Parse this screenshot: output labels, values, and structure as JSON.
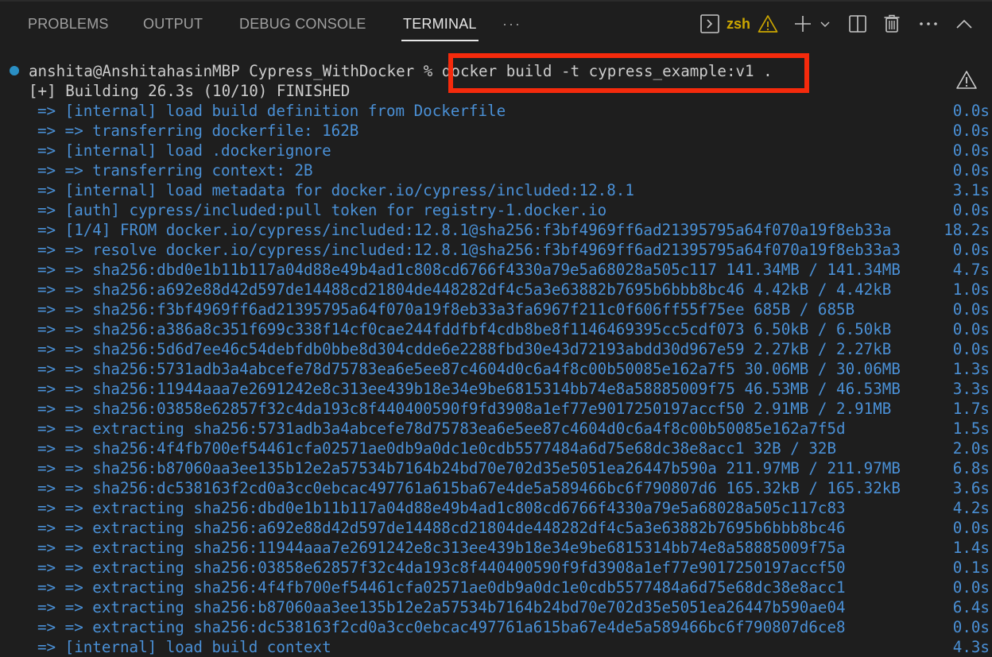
{
  "panel": {
    "tabs": [
      {
        "label": "PROBLEMS",
        "active": false
      },
      {
        "label": "OUTPUT",
        "active": false
      },
      {
        "label": "DEBUG CONSOLE",
        "active": false
      },
      {
        "label": "TERMINAL",
        "active": true
      }
    ],
    "more_tabs": "···",
    "terminal_name": "zsh",
    "icons": [
      "terminal-icon",
      "warning-icon",
      "new-terminal-plus-icon",
      "chevron-down-icon",
      "split-terminal-icon",
      "trash-icon",
      "more-actions-icon",
      "maximize-chevron-up-icon"
    ],
    "colors": {
      "background": "#1e1e1e",
      "output_blue": "#4a90d6",
      "text_white": "#cccccc",
      "warning_yellow": "#cca700",
      "highlight_red": "#f52a0c",
      "prompt_dot": "#2a8fc4"
    }
  },
  "terminal": {
    "prompt": "anshita@AnshitahasinMBP Cypress_WithDocker % ",
    "command": "docker build -t cypress_example:v1 .",
    "status_line": "[+] Building 26.3s (10/10) FINISHED",
    "lines": [
      {
        "text": "=> [internal] load build definition from Dockerfile",
        "time": "0.0s"
      },
      {
        "text": "=> => transferring dockerfile: 162B",
        "time": "0.0s"
      },
      {
        "text": "=> [internal] load .dockerignore",
        "time": "0.0s"
      },
      {
        "text": "=> => transferring context: 2B",
        "time": "0.0s"
      },
      {
        "text": "=> [internal] load metadata for docker.io/cypress/included:12.8.1",
        "time": "3.1s"
      },
      {
        "text": "=> [auth] cypress/included:pull token for registry-1.docker.io",
        "time": "0.0s"
      },
      {
        "text": "=> [1/4] FROM docker.io/cypress/included:12.8.1@sha256:f3bf4969ff6ad21395795a64f070a19f8eb33a",
        "time": "18.2s"
      },
      {
        "text": "=> => resolve docker.io/cypress/included:12.8.1@sha256:f3bf4969ff6ad21395795a64f070a19f8eb33a3",
        "time": "0.0s"
      },
      {
        "text": "=> => sha256:dbd0e1b11b117a04d88e49b4ad1c808cd6766f4330a79e5a68028a505c117 141.34MB / 141.34MB",
        "time": "4.7s"
      },
      {
        "text": "=> => sha256:a692e88d42d597de14488cd21804de448282df4c5a3e63882b7695b6bbb8bc46 4.42kB / 4.42kB",
        "time": "1.0s"
      },
      {
        "text": "=> => sha256:f3bf4969ff6ad21395795a64f070a19f8eb33a3fa6967f211c0f606ff55f75ee 685B / 685B",
        "time": "0.0s"
      },
      {
        "text": "=> => sha256:a386a8c351f699c338f14cf0cae244fddfbf4cdb8be8f1146469395cc5cdf073 6.50kB / 6.50kB",
        "time": "0.0s"
      },
      {
        "text": "=> => sha256:5d6d7ee46c54debfdb0bbe8d304cdde6e2288fbd30e43d72193abdd30d967e59 2.27kB / 2.27kB",
        "time": "0.0s"
      },
      {
        "text": "=> => sha256:5731adb3a4abcefe78d75783ea6e5ee87c4604d0c6a4f8c00b50085e162a7f5 30.06MB / 30.06MB",
        "time": "1.3s"
      },
      {
        "text": "=> => sha256:11944aaa7e2691242e8c313ee439b18e34e9be6815314bb74e8a58885009f75 46.53MB / 46.53MB",
        "time": "3.3s"
      },
      {
        "text": "=> => sha256:03858e62857f32c4da193c8f440400590f9fd3908a1ef77e9017250197accf50 2.91MB / 2.91MB",
        "time": "1.7s"
      },
      {
        "text": "=> => extracting sha256:5731adb3a4abcefe78d75783ea6e5ee87c4604d0c6a4f8c00b50085e162a7f5d",
        "time": "1.5s"
      },
      {
        "text": "=> => sha256:4f4fb700ef54461cfa02571ae0db9a0dc1e0cdb5577484a6d75e68dc38e8acc1 32B / 32B",
        "time": "2.0s"
      },
      {
        "text": "=> => sha256:b87060aa3ee135b12e2a57534b7164b24bd70e702d35e5051ea26447b590a 211.97MB / 211.97MB",
        "time": "6.8s"
      },
      {
        "text": "=> => sha256:dc538163f2cd0a3cc0ebcac497761a615ba67e4de5a589466bc6f790807d6 165.32kB / 165.32kB",
        "time": "3.6s"
      },
      {
        "text": "=> => extracting sha256:dbd0e1b11b117a04d88e49b4ad1c808cd6766f4330a79e5a68028a505c117c83",
        "time": "4.2s"
      },
      {
        "text": "=> => extracting sha256:a692e88d42d597de14488cd21804de448282df4c5a3e63882b7695b6bbb8bc46",
        "time": "0.0s"
      },
      {
        "text": "=> => extracting sha256:11944aaa7e2691242e8c313ee439b18e34e9be6815314bb74e8a58885009f75a",
        "time": "1.4s"
      },
      {
        "text": "=> => extracting sha256:03858e62857f32c4da193c8f440400590f9fd3908a1ef77e9017250197accf50",
        "time": "0.1s"
      },
      {
        "text": "=> => extracting sha256:4f4fb700ef54461cfa02571ae0db9a0dc1e0cdb5577484a6d75e68dc38e8acc1",
        "time": "0.0s"
      },
      {
        "text": "=> => extracting sha256:b87060aa3ee135b12e2a57534b7164b24bd70e702d35e5051ea26447b590ae04",
        "time": "6.4s"
      },
      {
        "text": "=> => extracting sha256:dc538163f2cd0a3cc0ebcac497761a615ba67e4de5a589466bc6f790807d6ce8",
        "time": "0.0s"
      },
      {
        "text": "=> [internal] load build context",
        "time": "4.3s"
      }
    ]
  }
}
